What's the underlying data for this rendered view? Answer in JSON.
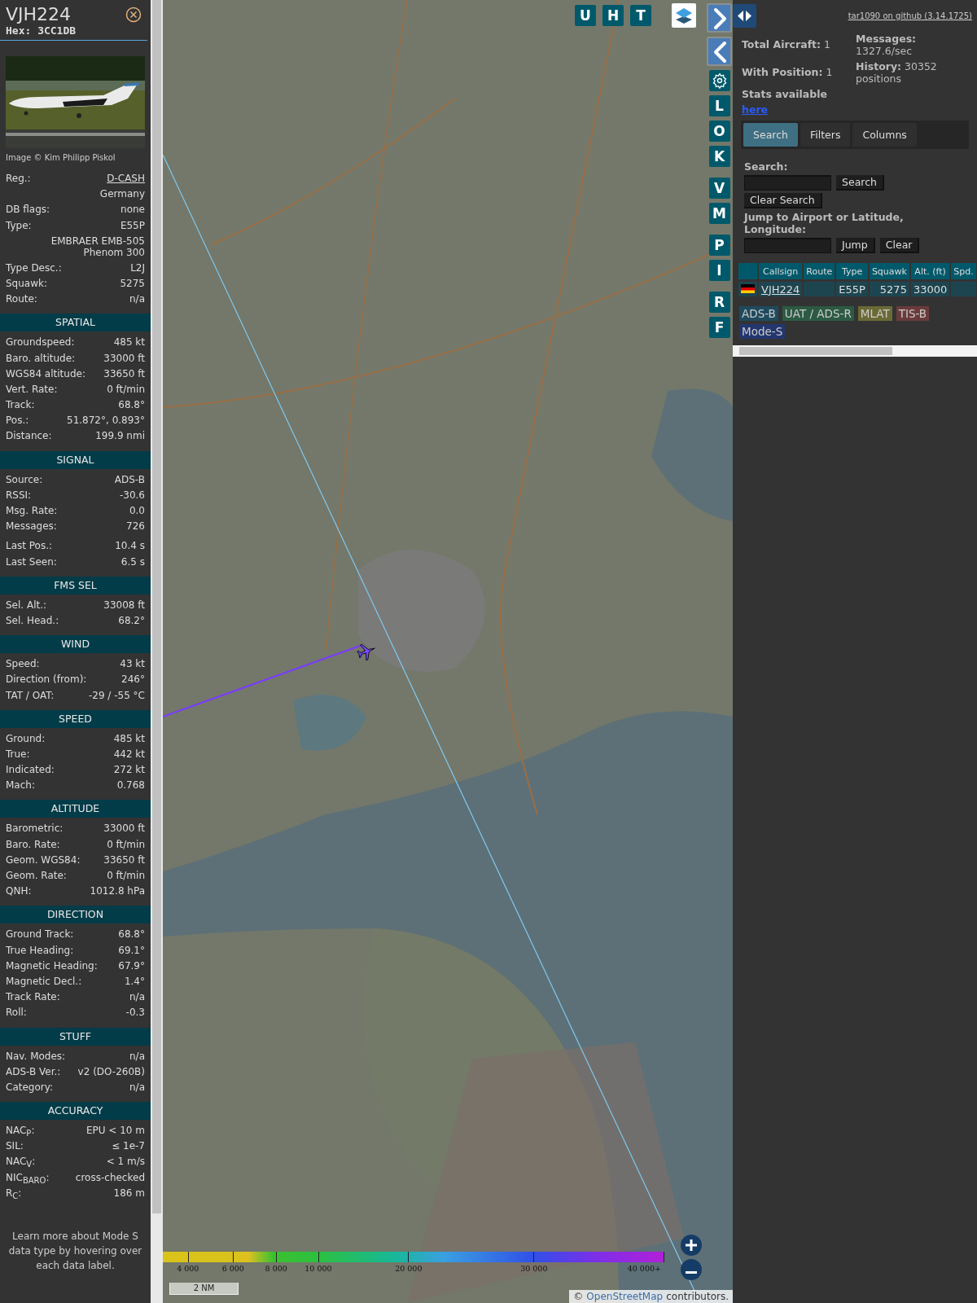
{
  "sidebar": {
    "callsign": "VJH224",
    "hex": "Hex: 3CC1DB",
    "photo": {
      "kind": "picture"
    },
    "photo_credit": "Image © Kim Philipp Piskol",
    "info_groups": [
      [
        {
          "label": "Reg.:",
          "value": "D-CASH",
          "kind": "link"
        },
        {
          "value": "Germany",
          "kind": "text"
        },
        {
          "label": "DB flags:",
          "value": "none",
          "kind": "text"
        },
        {
          "label": "Type:",
          "value": "E55P",
          "kind": "text"
        },
        {
          "value": "EMBRAER EMB-505 Phenom 300",
          "kind": "wrap"
        }
      ],
      [
        {
          "label": "Type Desc.:",
          "value": "L2J",
          "kind": "text"
        },
        {
          "label": "Squawk:",
          "value": "5275",
          "kind": "text"
        },
        {
          "label": "Route:",
          "value": "n/a",
          "kind": "text"
        }
      ]
    ],
    "sections": [
      {
        "title": "SPATIAL",
        "groups": [
          [
            {
              "label": "Groundspeed:",
              "value": "485 kt"
            },
            {
              "label": "Baro. altitude:",
              "value": "33000 ft"
            },
            {
              "label": "WGS84 altitude:",
              "value": "33650 ft"
            },
            {
              "label": "Vert. Rate:",
              "value": "0 ft/min"
            },
            {
              "label": "Track:",
              "value": "68.8°"
            },
            {
              "label": "Pos.:",
              "value": "51.872°, 0.893°"
            },
            {
              "label": "Distance:",
              "value": "199.9 nmi"
            }
          ]
        ]
      },
      {
        "title": "SIGNAL",
        "groups": [
          [
            {
              "label": "Source:",
              "value": "ADS-B"
            },
            {
              "label": "RSSI:",
              "value": "-30.6"
            },
            {
              "label": "Msg. Rate:",
              "value": "0.0"
            },
            {
              "label": "Messages:",
              "value": "726"
            }
          ],
          [
            {
              "label": "Last Pos.:",
              "value": "10.4 s"
            },
            {
              "label": "Last Seen:",
              "value": "6.5 s"
            }
          ]
        ]
      },
      {
        "title": "FMS SEL",
        "groups": [
          [
            {
              "label": "Sel. Alt.:",
              "value": "33008 ft"
            },
            {
              "label": "Sel. Head.:",
              "value": "68.2°"
            }
          ]
        ]
      },
      {
        "title": "WIND",
        "groups": [
          [
            {
              "label": "Speed:",
              "value": "43 kt"
            },
            {
              "label": "Direction (from):",
              "value": "246°"
            },
            {
              "label": "TAT / OAT:",
              "value": "-29 / -55 °C"
            }
          ]
        ]
      },
      {
        "title": "SPEED",
        "groups": [
          [
            {
              "label": "Ground:",
              "value": "485 kt"
            },
            {
              "label": "True:",
              "value": "442 kt"
            },
            {
              "label": "Indicated:",
              "value": "272 kt"
            },
            {
              "label": "Mach:",
              "value": "0.768"
            }
          ]
        ]
      },
      {
        "title": "ALTITUDE",
        "groups": [
          [
            {
              "label": "Barometric:",
              "value": "33000 ft"
            },
            {
              "label": "Baro. Rate:",
              "value": "0 ft/min"
            },
            {
              "label": "Geom. WGS84:",
              "value": "33650 ft"
            },
            {
              "label": "Geom. Rate:",
              "value": "0 ft/min"
            },
            {
              "label": "QNH:",
              "value": "1012.8 hPa"
            }
          ]
        ]
      },
      {
        "title": "DIRECTION",
        "groups": [
          [
            {
              "label": "Ground Track:",
              "value": "68.8°"
            },
            {
              "label": "True Heading:",
              "value": "69.1°"
            },
            {
              "label": "Magnetic Heading:",
              "value": "67.9°"
            },
            {
              "label": "Magnetic Decl.:",
              "value": "1.4°"
            },
            {
              "label": "Track Rate:",
              "value": "n/a"
            },
            {
              "label": "Roll:",
              "value": "-0.3"
            }
          ]
        ]
      },
      {
        "title": "STUFF",
        "groups": [
          [
            {
              "label": "Nav. Modes:",
              "value": "n/a"
            },
            {
              "label": "ADS-B Ver.:",
              "value": "v2 (DO-260B)"
            },
            {
              "label": "Category:",
              "value": "n/a"
            }
          ]
        ]
      },
      {
        "title": "ACCURACY",
        "groups": [
          [
            {
              "label": "NAC$_{P}$:",
              "value": "EPU < 10 m"
            },
            {
              "label": "SIL:",
              "value": "≤ 1e-7"
            },
            {
              "label": "NAC$_{V}$:",
              "value": "< 1 m/s"
            },
            {
              "label": "NIC$_{BARO}$:",
              "value": "cross-checked"
            },
            {
              "label": "R$_{C}$:",
              "value": "186 m"
            }
          ]
        ]
      }
    ],
    "footer_note": "Learn more about Mode S data type by hovering over each data label."
  },
  "map": {
    "picture": {
      "kind": "picture"
    },
    "top_buttons": [
      "U",
      "H",
      "T"
    ],
    "side_button_groups": [
      [
        {
          "kind": "next"
        },
        {
          "kind": "prev"
        },
        {
          "kind": "settings"
        },
        {
          "kind": "letter",
          "label": "L"
        },
        {
          "kind": "letter",
          "label": "O"
        },
        {
          "kind": "letter",
          "label": "K"
        }
      ],
      [
        {
          "kind": "letter",
          "label": "V"
        },
        {
          "kind": "letter",
          "label": "M"
        }
      ],
      [
        {
          "kind": "letter",
          "label": "P"
        },
        {
          "kind": "letter",
          "label": "I"
        }
      ],
      [
        {
          "kind": "letter",
          "label": "R"
        },
        {
          "kind": "letter",
          "label": "F"
        }
      ]
    ],
    "altitude_legend": [
      "4 000",
      "6 000",
      "8 000",
      "10 000",
      "20 000",
      "30 000",
      "40 000+"
    ],
    "scale": "2 NM",
    "attribution": {
      "prefix": "©",
      "link": "OpenStreetMap",
      "suffix": "contributors."
    }
  },
  "panel": {
    "github_link": "tar1090 on github (3.14.1725)",
    "stats_left": [
      "**Total Aircraft:** 1",
      "**With Position:** 1"
    ],
    "stats_available": "Stats available",
    "stats_link": "here",
    "stats_right": [
      "**Messages:** 1327.6/sec",
      "**History:** 30352 positions"
    ],
    "tabs": [
      {
        "label": "Search",
        "selected": true
      },
      {
        "label": "Filters",
        "selected": false
      },
      {
        "label": "Columns",
        "selected": false
      }
    ],
    "search_label": "Search:",
    "search_button": "Search",
    "clear_search_button": "Clear Search",
    "jump_label": "Jump to Airport or Latitude, Longitude:",
    "jump_button": "Jump",
    "clear_button": "Clear",
    "table": {
      "columns": [
        "Callsign",
        "Route",
        "Type",
        "Squawk",
        "Alt. (ft)",
        "Spd."
      ],
      "rows": [
        {
          "callsign": "VJH224",
          "type": "E55P",
          "squawk": "5275",
          "altitude": "33000"
        }
      ]
    },
    "sources": [
      {
        "label": "ADS-B",
        "color": "#1f4a5e"
      },
      {
        "label": "UAT / ADS-R",
        "color": "#2c5a43"
      },
      {
        "label": "MLAT",
        "color": "#6a6a36"
      },
      {
        "label": "TIS-B",
        "color": "#6a3b3b"
      },
      {
        "label": "Mode-S",
        "color": "#23366e"
      }
    ]
  }
}
